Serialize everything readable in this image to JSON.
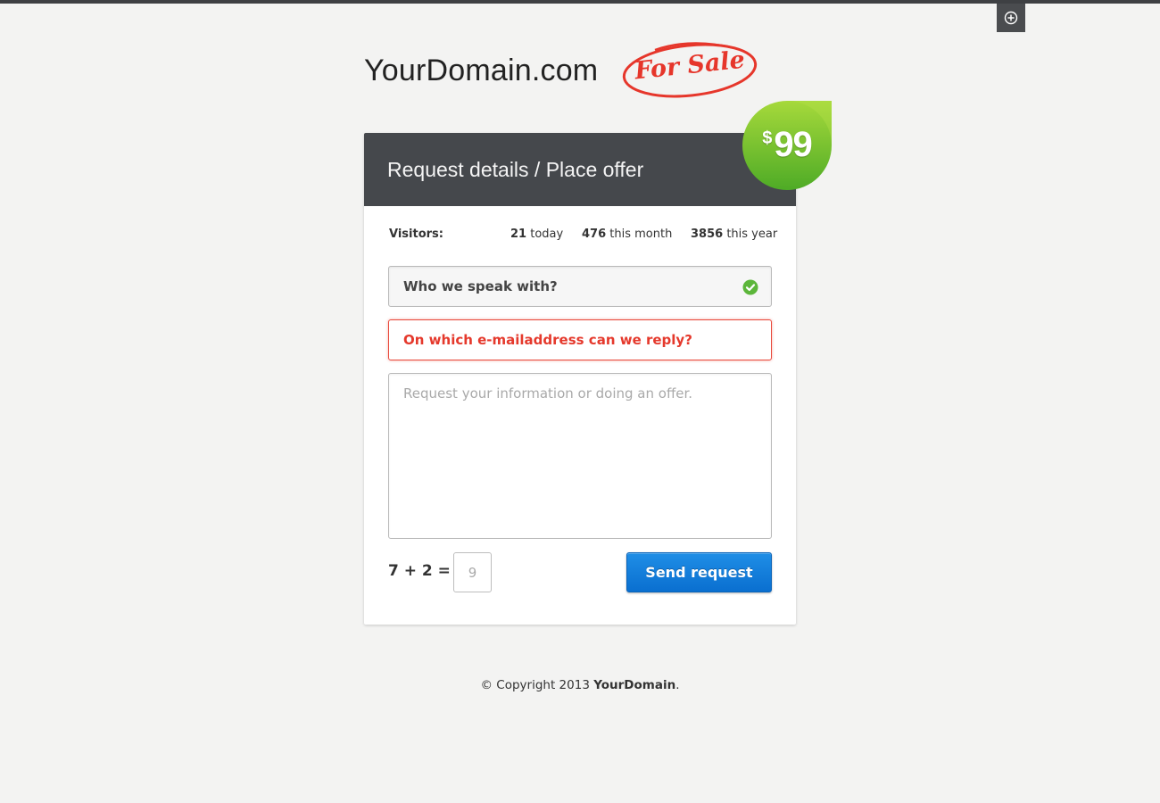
{
  "brand": {
    "domain": "YourDomain.com",
    "stamp": "For Sale"
  },
  "toolbar": {
    "expand_icon": "circle-plus-icon"
  },
  "price": {
    "currency": "$",
    "value": "99",
    "badge_color": "#6cbf2a"
  },
  "form": {
    "title": "Request details / Place offer",
    "stats": {
      "label": "Visitors:",
      "today_count": "21",
      "today_label": "today",
      "month_count": "476",
      "month_label": "this month",
      "year_count": "3856",
      "year_label": "this year"
    },
    "name_field": {
      "placeholder": "Who we speak with?",
      "status_icon": "check-circle-icon",
      "status_color": "#5cb63a"
    },
    "email_field": {
      "placeholder": "On which e-mailaddress can we reply?",
      "error_color": "#e5392c"
    },
    "message_field": {
      "placeholder": "Request your information or doing an offer."
    },
    "captcha": {
      "question": "7 + 2 =",
      "answer": "9"
    },
    "submit_label": "Send request",
    "accent_color": "#0a6fd0"
  },
  "footer": {
    "prefix": "© Copyright 2013",
    "brand": "YourDomain",
    "suffix": "."
  }
}
